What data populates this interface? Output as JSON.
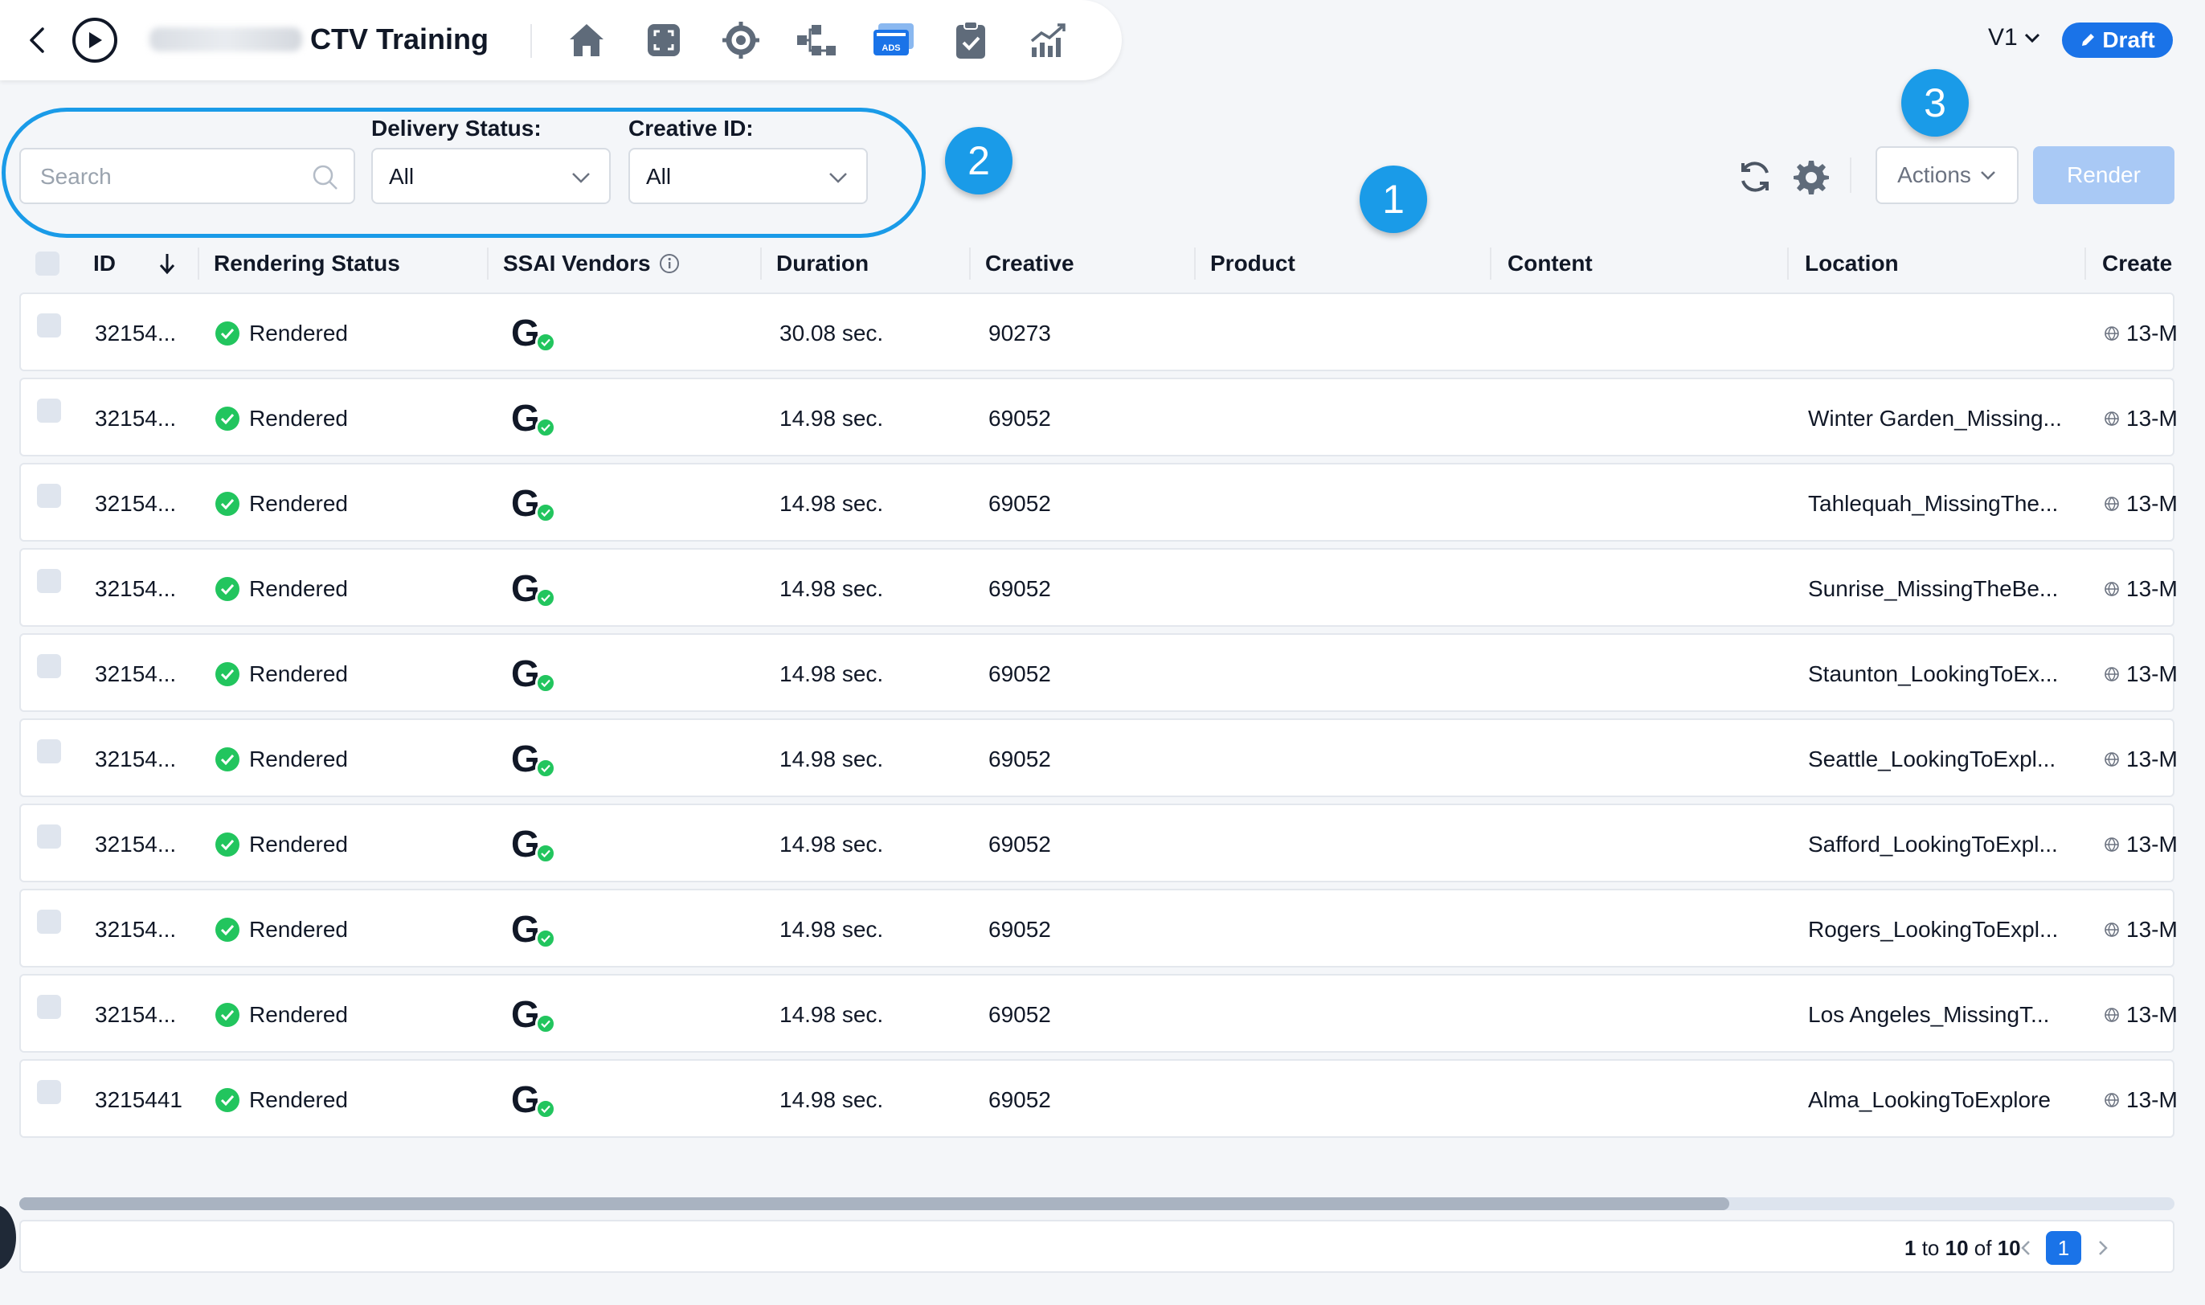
{
  "topbar": {
    "title": "CTV Training",
    "version": "V1",
    "draft_label": "Draft",
    "nav_icons": [
      "home-icon",
      "focus-frame-icon",
      "target-icon",
      "hierarchy-icon",
      "ads-icon",
      "clipboard-check-icon",
      "analytics-chart-icon"
    ]
  },
  "filters": {
    "search_placeholder": "Search",
    "delivery_status_label": "Delivery Status:",
    "delivery_status_value": "All",
    "creative_id_label": "Creative ID:",
    "creative_id_value": "All"
  },
  "badges": {
    "one": "1",
    "two": "2",
    "three": "3"
  },
  "toolbar": {
    "actions_label": "Actions",
    "render_label": "Render"
  },
  "table": {
    "columns": {
      "id": "ID",
      "rendering_status": "Rendering Status",
      "ssai_vendors": "SSAI Vendors",
      "duration": "Duration",
      "creative": "Creative",
      "product": "Product",
      "content": "Content",
      "location": "Location",
      "created": "Create"
    },
    "rows": [
      {
        "id": "32154...",
        "status": "Rendered",
        "vendor": "G",
        "duration": "30.08 sec.",
        "creative": "90273",
        "product": "",
        "content": "",
        "location": "",
        "created": "13-M"
      },
      {
        "id": "32154...",
        "status": "Rendered",
        "vendor": "G",
        "duration": "14.98 sec.",
        "creative": "69052",
        "product": "",
        "content": "",
        "location": "Winter Garden_Missing...",
        "created": "13-M"
      },
      {
        "id": "32154...",
        "status": "Rendered",
        "vendor": "G",
        "duration": "14.98 sec.",
        "creative": "69052",
        "product": "",
        "content": "",
        "location": "Tahlequah_MissingThe...",
        "created": "13-M"
      },
      {
        "id": "32154...",
        "status": "Rendered",
        "vendor": "G",
        "duration": "14.98 sec.",
        "creative": "69052",
        "product": "",
        "content": "",
        "location": "Sunrise_MissingTheBe...",
        "created": "13-M"
      },
      {
        "id": "32154...",
        "status": "Rendered",
        "vendor": "G",
        "duration": "14.98 sec.",
        "creative": "69052",
        "product": "",
        "content": "",
        "location": "Staunton_LookingToEx...",
        "created": "13-M"
      },
      {
        "id": "32154...",
        "status": "Rendered",
        "vendor": "G",
        "duration": "14.98 sec.",
        "creative": "69052",
        "product": "",
        "content": "",
        "location": "Seattle_LookingToExpl...",
        "created": "13-M"
      },
      {
        "id": "32154...",
        "status": "Rendered",
        "vendor": "G",
        "duration": "14.98 sec.",
        "creative": "69052",
        "product": "",
        "content": "",
        "location": "Safford_LookingToExpl...",
        "created": "13-M"
      },
      {
        "id": "32154...",
        "status": "Rendered",
        "vendor": "G",
        "duration": "14.98 sec.",
        "creative": "69052",
        "product": "",
        "content": "",
        "location": "Rogers_LookingToExpl...",
        "created": "13-M"
      },
      {
        "id": "32154...",
        "status": "Rendered",
        "vendor": "G",
        "duration": "14.98 sec.",
        "creative": "69052",
        "product": "",
        "content": "",
        "location": "Los Angeles_MissingT...",
        "created": "13-M"
      },
      {
        "id": "3215441",
        "status": "Rendered",
        "vendor": "G",
        "duration": "14.98 sec.",
        "creative": "69052",
        "product": "",
        "content": "",
        "location": "Alma_LookingToExplore",
        "created": "13-M"
      }
    ]
  },
  "pagination": {
    "from": "1",
    "to_word": "to",
    "to": "10",
    "of_word": "of",
    "total": "10",
    "current_page": "1"
  },
  "colors": {
    "accent": "#1a73e8",
    "annotation": "#1a9be8",
    "success": "#22c55e"
  }
}
